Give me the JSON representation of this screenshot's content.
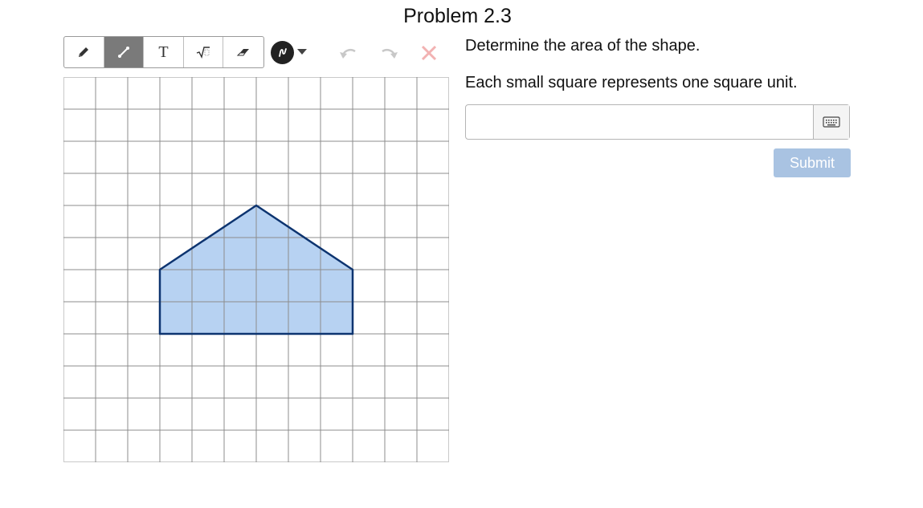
{
  "problem": {
    "title": "Problem 2.3",
    "question_line1": "Determine the area of the shape.",
    "question_line2": "Each small square represents one square unit."
  },
  "toolbar": {
    "tools": [
      {
        "name": "pencil",
        "icon": "pencil-icon",
        "active": false
      },
      {
        "name": "line",
        "icon": "line-segment-icon",
        "active": true
      },
      {
        "name": "text",
        "icon": "text-icon",
        "label": "T",
        "active": false
      },
      {
        "name": "math",
        "icon": "square-root-icon",
        "active": false
      },
      {
        "name": "eraser",
        "icon": "eraser-icon",
        "active": false
      }
    ],
    "color_icon": "pen-color-icon",
    "undo_icon": "undo-icon",
    "redo_icon": "redo-icon",
    "clear_icon": "clear-x-icon"
  },
  "grid": {
    "columns": 12,
    "rows": 12,
    "shape_vertices": [
      [
        3,
        8
      ],
      [
        3,
        6
      ],
      [
        6,
        4
      ],
      [
        9,
        6
      ],
      [
        9,
        8
      ]
    ],
    "shape_fill": "#b7d2f2",
    "shape_stroke": "#0d3470"
  },
  "answer": {
    "value": "",
    "placeholder": "",
    "keyboard_icon": "keyboard-icon"
  },
  "submit_label": "Submit",
  "colors": {
    "submit_bg": "#a9c3e2",
    "active_tool_bg": "#7a7a7a",
    "disabled_icon": "#c8c8c8",
    "clear_icon": "#f2b2b2"
  }
}
